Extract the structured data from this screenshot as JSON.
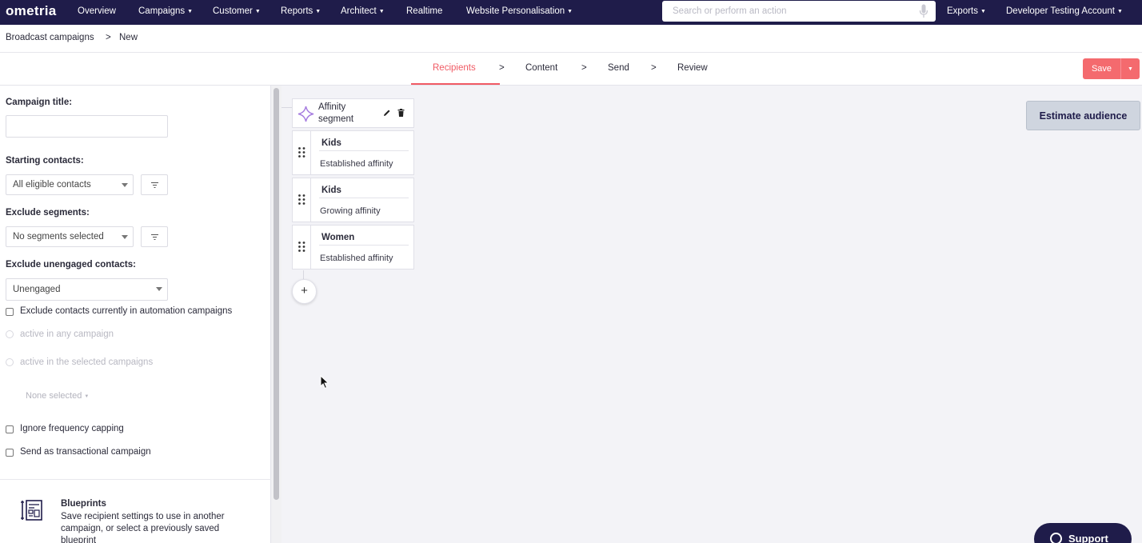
{
  "nav": {
    "logo": "ometria",
    "items": [
      {
        "label": "Overview",
        "caret": false
      },
      {
        "label": "Campaigns",
        "caret": true
      },
      {
        "label": "Customer",
        "caret": true
      },
      {
        "label": "Reports",
        "caret": true
      },
      {
        "label": "Architect",
        "caret": true
      },
      {
        "label": "Realtime",
        "caret": false
      },
      {
        "label": "Website Personalisation",
        "caret": true
      }
    ],
    "search_placeholder": "Search or perform an action",
    "exports": "Exports",
    "account": "Developer Testing Account"
  },
  "breadcrumb": {
    "root": "Broadcast campaigns",
    "sep": ">",
    "current": "New"
  },
  "steps": {
    "items": [
      "Recipients",
      "Content",
      "Send",
      "Review"
    ],
    "sep": ">",
    "active": "Recipients",
    "save": "Save"
  },
  "form": {
    "campaign_title_label": "Campaign title:",
    "campaign_title_value": "",
    "starting_contacts_label": "Starting contacts:",
    "starting_contacts_value": "All eligible contacts",
    "exclude_segments_label": "Exclude segments:",
    "exclude_segments_value": "No segments selected",
    "exclude_unengaged_label": "Exclude unengaged contacts:",
    "exclude_unengaged_value": "Unengaged",
    "exclude_automation_label": "Exclude contacts currently in automation campaigns",
    "radio_any": "active in any campaign",
    "radio_selected": "active in the selected campaigns",
    "none_selected": "None selected",
    "ignore_freq_label": "Ignore frequency capping",
    "transactional_label": "Send as transactional campaign"
  },
  "blueprints": {
    "title": "Blueprints",
    "description": "Save recipient settings to use in another campaign, or select a previously saved blueprint"
  },
  "segment": {
    "title_line1": "Affinity",
    "title_line2": "segment",
    "rows": [
      {
        "name": "Kids",
        "affinity": "Established affinity"
      },
      {
        "name": "Kids",
        "affinity": "Growing affinity"
      },
      {
        "name": "Women",
        "affinity": "Established affinity"
      }
    ],
    "add": "+"
  },
  "estimate_audience": "Estimate audience",
  "support": "Support",
  "colors": {
    "nav_bg": "#1f1c4a",
    "accent": "#f05a64",
    "save_bg": "#f46a6e"
  }
}
